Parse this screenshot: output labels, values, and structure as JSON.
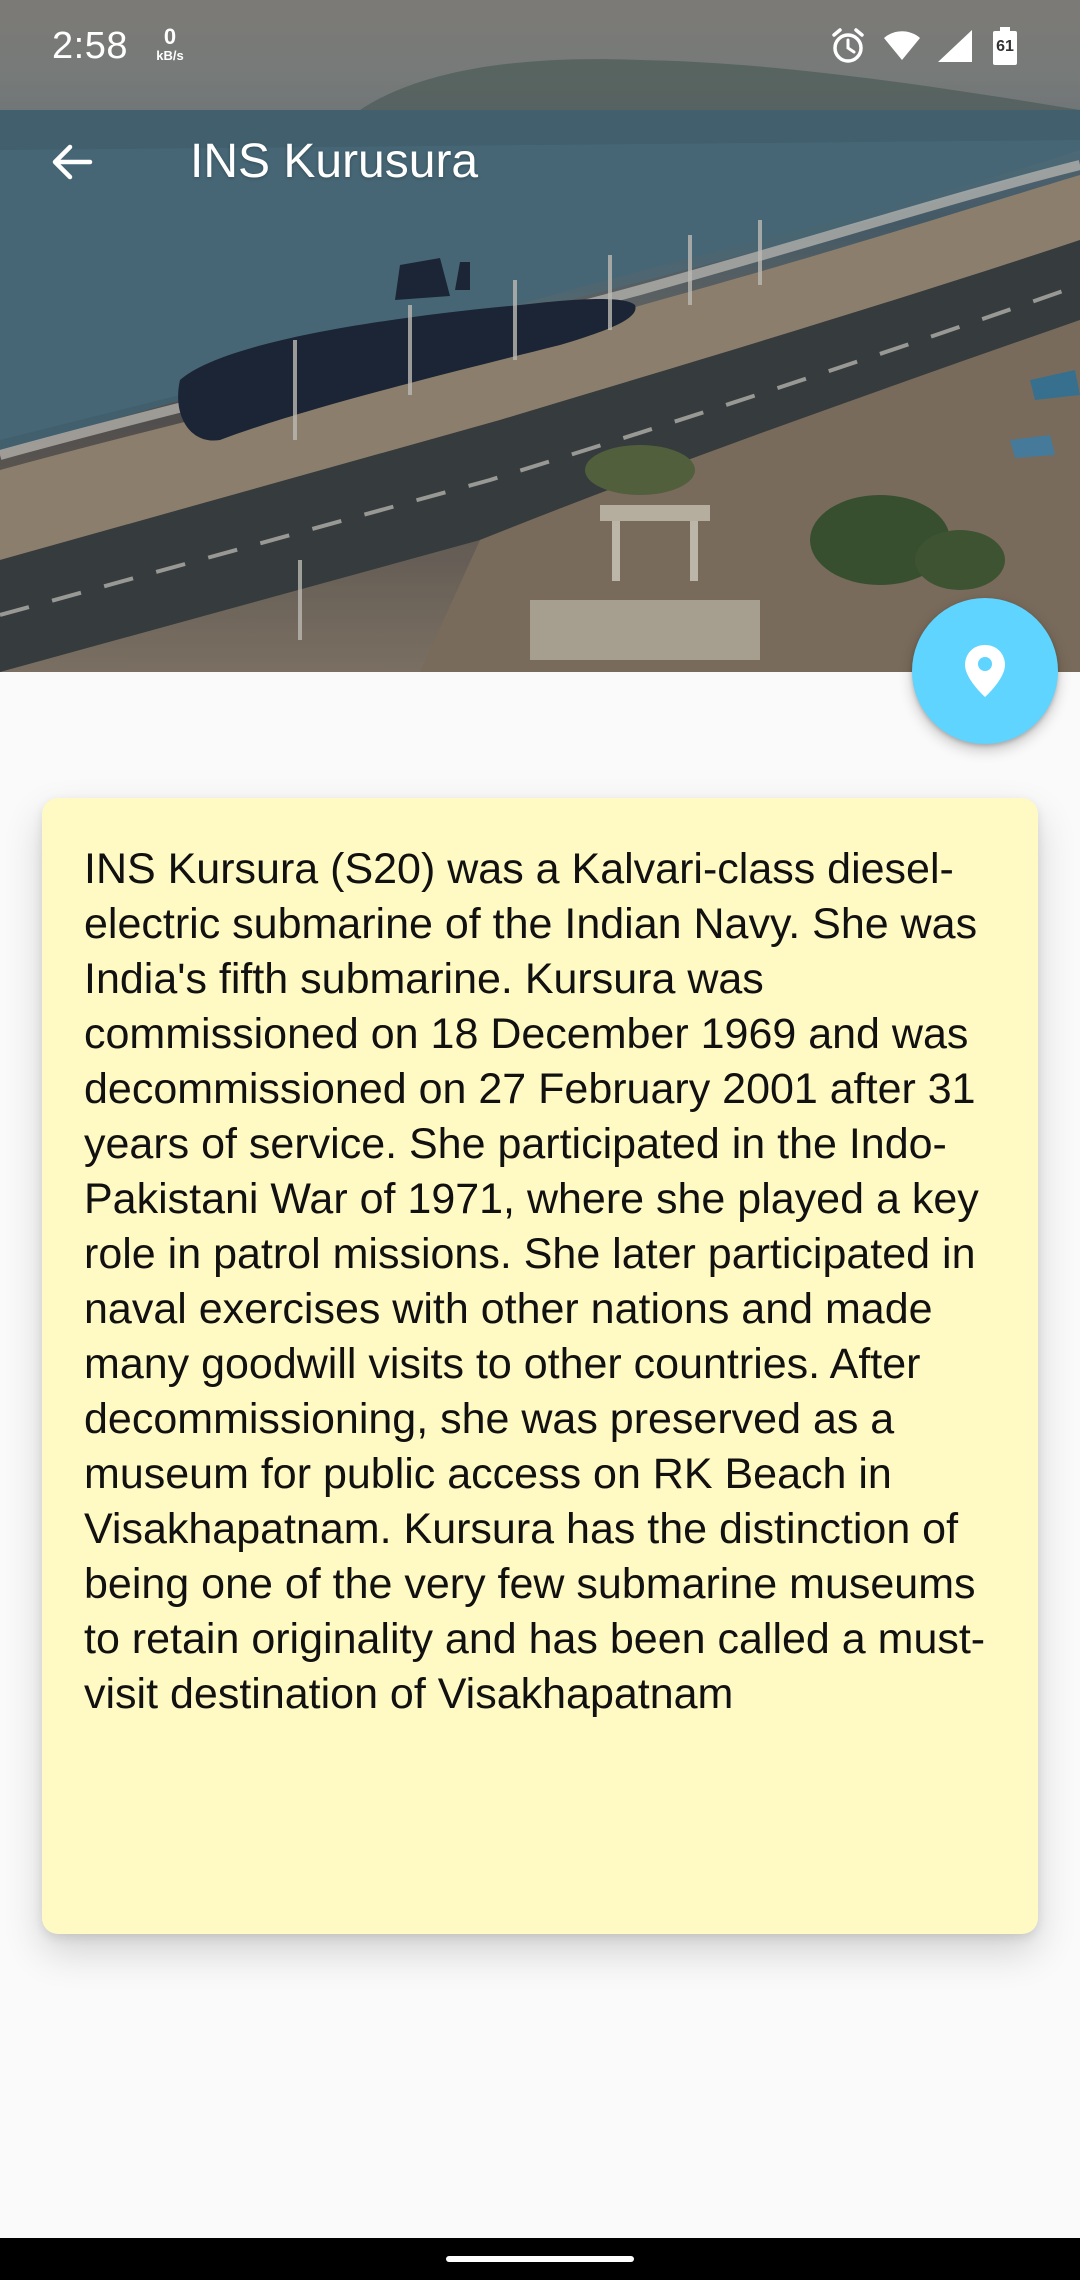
{
  "status_bar": {
    "time": "2:58",
    "network_speed_value": "0",
    "network_speed_unit": "kB/s",
    "battery_level": "61",
    "icons": [
      "alarm-icon",
      "wifi-icon",
      "cell-signal-icon",
      "battery-icon"
    ]
  },
  "app_bar": {
    "title": "INS Kurusura",
    "back_icon": "arrow-back-icon"
  },
  "hero": {
    "description": "header-photo"
  },
  "fab": {
    "icon": "location-pin-icon",
    "color": "#5ed4ff"
  },
  "card": {
    "background": "#fff9c4",
    "text": "INS Kursura (S20) was a Kalvari-class diesel-electric submarine of the Indian Navy. She was India's fifth submarine. Kursura was commissioned on 18 December 1969 and was decommissioned on 27 February 2001 after 31 years of service. She participated in the Indo-Pakistani War of 1971, where she played a key role in patrol missions. She later participated in naval exercises with other nations and made many goodwill visits to other countries. After decommissioning, she was preserved as a museum for public access on RK Beach in Visakhapatnam. Kursura has the distinction of being one of the very few submarine museums to retain originality and has been called a must-visit destination of Visakhapatnam"
  }
}
